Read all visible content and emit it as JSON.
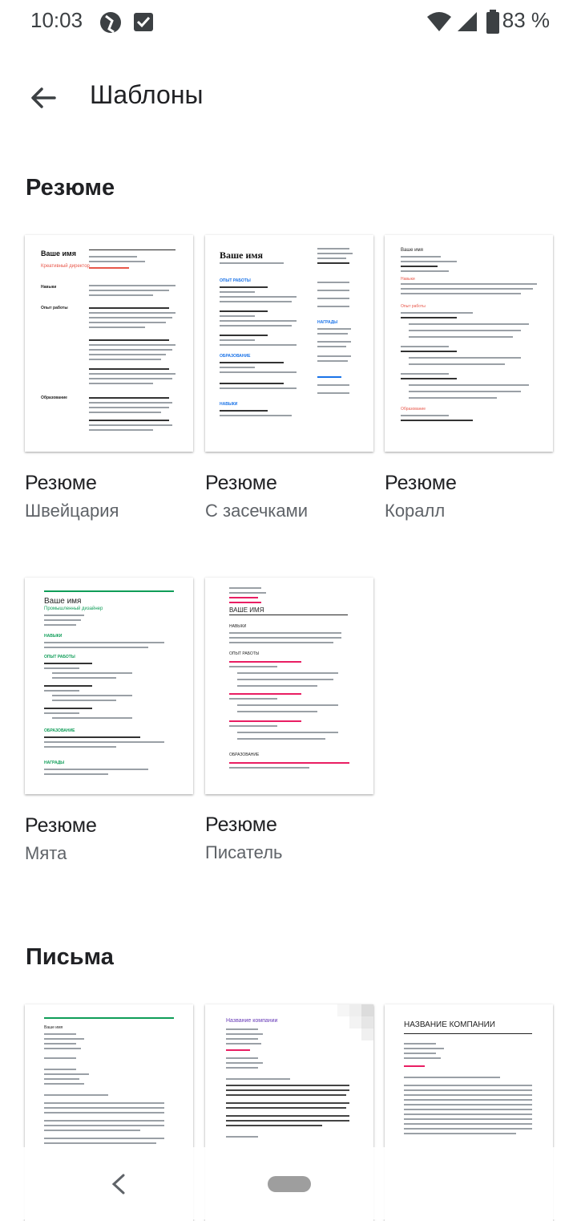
{
  "status": {
    "time": "10:03",
    "battery": "83 %"
  },
  "appbar": {
    "title": "Шаблоны"
  },
  "sections": {
    "resume": "Резюме",
    "letters": "Письма"
  },
  "templates": [
    {
      "title": "Резюме",
      "subtitle": "Швейцария"
    },
    {
      "title": "Резюме",
      "subtitle": "С засечками"
    },
    {
      "title": "Резюме",
      "subtitle": "Коралл"
    },
    {
      "title": "Резюме",
      "subtitle": "Мята"
    },
    {
      "title": "Резюме",
      "subtitle": "Писатель"
    }
  ],
  "previews": {
    "swiss": {
      "name": "Ваше имя",
      "role": "Креативный директор",
      "s1": "Навыки",
      "s2": "Опыт работы",
      "s3": "Образование"
    },
    "serif": {
      "name": "Ваше имя",
      "s1": "ОПЫТ РАБОТЫ",
      "s2": "ОБРАЗОВАНИЕ",
      "s3": "НАВЫКИ",
      "s4": "НАГРАДЫ"
    },
    "coral": {
      "name": "Ваше имя",
      "s1": "Навыки",
      "s2": "Опыт работы",
      "s3": "Образование"
    },
    "mint": {
      "name": "Ваше имя",
      "role": "Промышленный дизайнер",
      "s1": "НАВЫКИ",
      "s2": "ОПЫТ РАБОТЫ",
      "s3": "ОБРАЗОВАНИЕ",
      "s4": "НАГРАДЫ"
    },
    "writer": {
      "name": "ВАШЕ ИМЯ",
      "s1": "НАВЫКИ",
      "s2": "ОПЫТ РАБОТЫ",
      "s3": "ОБРАЗОВАНИЕ"
    },
    "letter1": {
      "name": "Ваше имя"
    },
    "letter2": {
      "company": "Название компании"
    },
    "letter3": {
      "company": "НАЗВАНИЕ КОМПАНИИ"
    }
  },
  "colors": {
    "coral": "#e8574a",
    "mint": "#0f9d58",
    "blue": "#1a73e8",
    "purple": "#673ab7",
    "pink": "#e91e63"
  }
}
